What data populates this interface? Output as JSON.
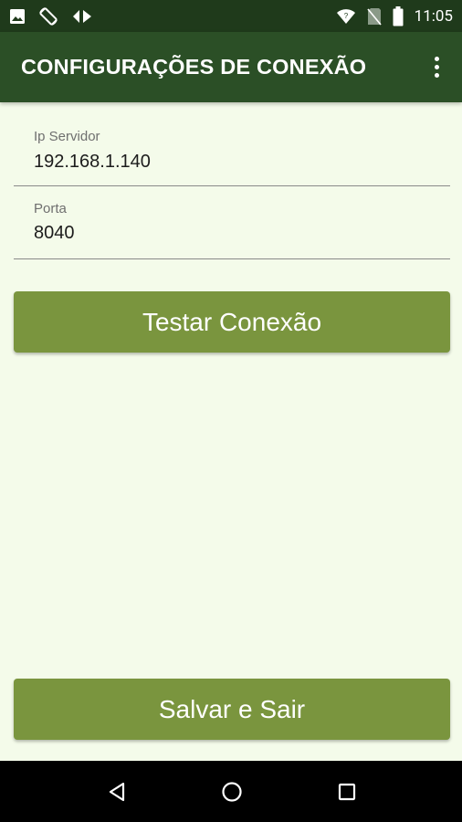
{
  "status_bar": {
    "time": "11:05",
    "left_icons": [
      "image-icon",
      "screen-rotation-icon",
      "data-transfer-icon"
    ],
    "right_icons": [
      "wifi-icon",
      "no-sim-icon",
      "battery-icon"
    ]
  },
  "app_bar": {
    "title": "CONFIGURAÇÕES DE CONEXÃO",
    "menu_icon": "more-vertical-icon"
  },
  "form": {
    "ip": {
      "label": "Ip Servidor",
      "value": "192.168.1.140"
    },
    "port": {
      "label": "Porta",
      "value": "8040"
    }
  },
  "buttons": {
    "test_label": "Testar Conexão",
    "save_label": "Salvar e Sair"
  },
  "nav_bar": {
    "icons": [
      "back-icon",
      "home-icon",
      "recents-icon"
    ]
  },
  "colors": {
    "status_bar": "#1f3a1b",
    "app_bar": "#2b4f26",
    "background": "#f4fbea",
    "button": "#7a953e",
    "nav_bar": "#000000"
  }
}
